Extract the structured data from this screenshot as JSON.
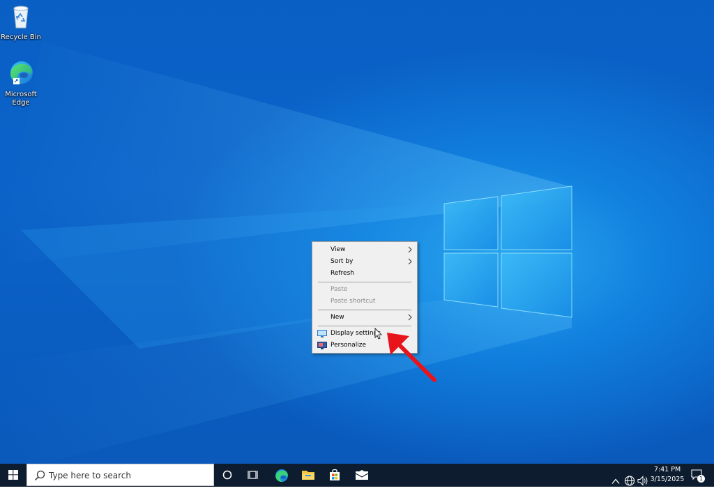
{
  "desktop": {
    "icons": [
      {
        "label": "Recycle Bin",
        "icon": "recycle-bin-icon"
      },
      {
        "label": "Microsoft Edge",
        "icon": "edge-icon"
      }
    ]
  },
  "context_menu": {
    "items": [
      {
        "label": "View",
        "submenu": true,
        "enabled": true
      },
      {
        "label": "Sort by",
        "submenu": true,
        "enabled": true
      },
      {
        "label": "Refresh",
        "submenu": false,
        "enabled": true
      },
      {
        "label": "Paste",
        "submenu": false,
        "enabled": false
      },
      {
        "label": "Paste shortcut",
        "submenu": false,
        "enabled": false
      },
      {
        "label": "New",
        "submenu": true,
        "enabled": true
      },
      {
        "label": "Display settings",
        "submenu": false,
        "enabled": true,
        "icon": "display-settings-icon"
      },
      {
        "label": "Personalize",
        "submenu": false,
        "enabled": true,
        "icon": "personalize-icon"
      }
    ]
  },
  "taskbar": {
    "search_placeholder": "Type here to search",
    "pinned": [
      "cortana-icon",
      "task-view-icon",
      "edge-icon",
      "file-explorer-icon",
      "store-icon",
      "mail-icon"
    ],
    "tray": {
      "time": "7:41 PM",
      "date": "3/15/2025",
      "notification_count": "1"
    }
  },
  "colors": {
    "annotation_arrow": "#e8141c",
    "taskbar_bg": "#0d1c2e"
  }
}
